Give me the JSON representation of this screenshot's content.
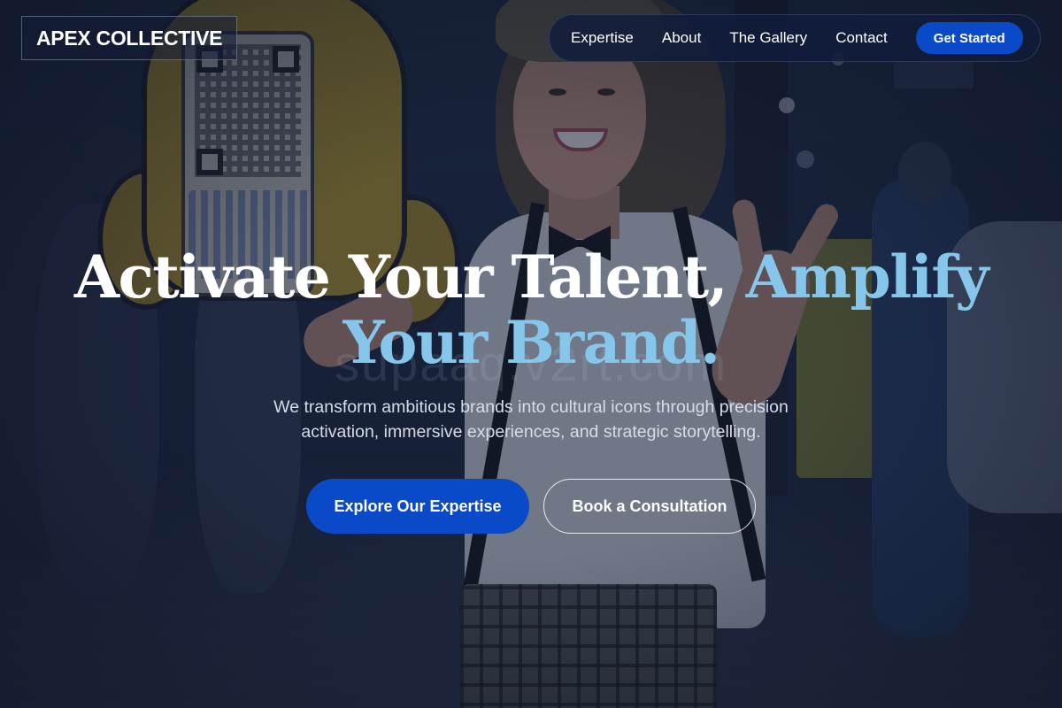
{
  "header": {
    "logo_text": "APEX COLLECTIVE",
    "nav": {
      "links": [
        "Expertise",
        "About",
        "The Gallery",
        "Contact"
      ],
      "cta_label": "Get Started"
    }
  },
  "hero": {
    "title_part1": "Activate Your Talent, ",
    "title_part2": "Amplify Your Brand.",
    "watermark": "supaaq.v2rt.com",
    "subtitle": "We transform ambitious brands into cultural icons through precision activation, immersive experiences, and strategic storytelling.",
    "primary_button": "Explore Our Expertise",
    "secondary_button": "Book a Consultation"
  },
  "colors": {
    "accent_blue": "#0a49c7",
    "title_highlight": "#86c6ea",
    "overlay": "#121b32"
  },
  "background": {
    "image_subject": "woman-at-expo-waving-with-mascot-sign"
  }
}
